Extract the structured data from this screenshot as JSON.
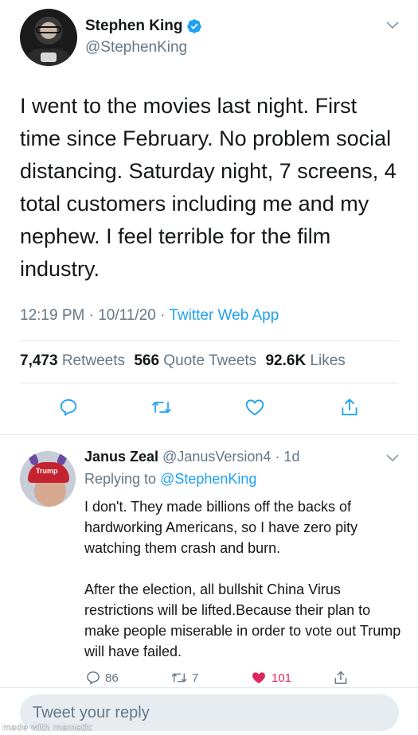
{
  "tweet": {
    "author_name": "Stephen King",
    "author_handle": "@StephenKing",
    "text": "I went to the movies last night. First time since February. No problem social distancing. Saturday night, 7 screens, 4 total customers including me and my nephew. I feel terrible for the film industry.",
    "time": "12:19 PM",
    "date": "10/11/20",
    "separator": "·",
    "source_app": "Twitter Web App",
    "retweets_count": "7,473",
    "retweets_label": "Retweets",
    "quote_count": "566",
    "quote_label": "Quote Tweets",
    "likes_count": "92.6K",
    "likes_label": "Likes",
    "icons": [
      "reply-icon",
      "retweet-icon",
      "like-icon",
      "share-icon"
    ]
  },
  "reply": {
    "author_name": "Janus Zeal",
    "author_handle": "@JanusVersion4",
    "age": "· 1d",
    "replying_prefix": "Replying to",
    "replying_to": "@StephenKing",
    "text": "I don't. They made billions off the backs of hardworking Americans, so I have zero pity watching them crash and burn.\n\nAfter the election, all bullshit China Virus restrictions will be lifted.Because their plan to make people miserable in order to vote out Trump will have failed.",
    "avatar_hat_text": "Trump",
    "reply_count": "86",
    "retweet_count": "7",
    "like_count": "101"
  },
  "compose": {
    "placeholder": "Tweet your reply"
  },
  "watermark": "made with mematic",
  "colors": {
    "accent": "#1da1f2",
    "secondary_text": "#657786",
    "like_red": "#e0245e",
    "divider": "#e1e8ed"
  }
}
